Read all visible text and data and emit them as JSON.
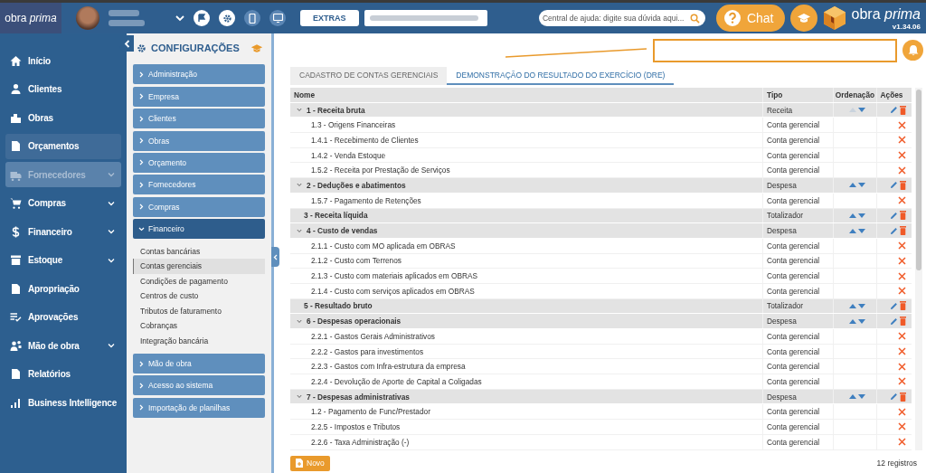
{
  "header": {
    "logo": "obra *prima*",
    "extras_button": "EXTRAS",
    "search": {
      "placeholder": "Central de ajuda: digite sua dúvida aqui..."
    },
    "chat_button": "Chat",
    "brand": "obra *prima*",
    "version": "v1.34.06"
  },
  "sidebar": {
    "items": [
      {
        "label": "Início",
        "has_submenu": false,
        "selected": false,
        "disabled": false
      },
      {
        "label": "Clientes",
        "has_submenu": false,
        "selected": false,
        "disabled": false
      },
      {
        "label": "Obras",
        "has_submenu": false,
        "selected": false,
        "disabled": false
      },
      {
        "label": "Orçamentos",
        "has_submenu": false,
        "selected": true,
        "disabled": false
      },
      {
        "label": "Fornecedores",
        "has_submenu": true,
        "selected": false,
        "disabled": true
      },
      {
        "label": "Compras",
        "has_submenu": true,
        "selected": false,
        "disabled": false
      },
      {
        "label": "Financeiro",
        "has_submenu": true,
        "selected": false,
        "disabled": false
      },
      {
        "label": "Estoque",
        "has_submenu": true,
        "selected": false,
        "disabled": false
      },
      {
        "label": "Apropriação",
        "has_submenu": false,
        "selected": false,
        "disabled": false
      },
      {
        "label": "Aprovações",
        "has_submenu": false,
        "selected": false,
        "disabled": false
      },
      {
        "label": "Mão de obra",
        "has_submenu": true,
        "selected": false,
        "disabled": false
      },
      {
        "label": "Relatórios",
        "has_submenu": false,
        "selected": false,
        "disabled": false
      },
      {
        "label": "Business Intelligence",
        "has_submenu": false,
        "selected": false,
        "disabled": false
      }
    ]
  },
  "settings_panel": {
    "title": "CONFIGURAÇÕES",
    "sections": [
      {
        "label": "Administração",
        "expanded": false
      },
      {
        "label": "Empresa",
        "expanded": false
      },
      {
        "label": "Clientes",
        "expanded": false
      },
      {
        "label": "Obras",
        "expanded": false
      },
      {
        "label": "Orçamento",
        "expanded": false
      },
      {
        "label": "Fornecedores",
        "expanded": false
      },
      {
        "label": "Compras",
        "expanded": false
      },
      {
        "label": "Financeiro",
        "expanded": true,
        "children": [
          {
            "label": "Contas bancárias",
            "selected": false
          },
          {
            "label": "Contas gerenciais",
            "selected": true
          },
          {
            "label": "Condições de pagamento",
            "selected": false
          },
          {
            "label": "Centros de custo",
            "selected": false
          },
          {
            "label": "Tributos de faturamento",
            "selected": false
          },
          {
            "label": "Cobranças",
            "selected": false
          },
          {
            "label": "Integração bancária",
            "selected": false
          }
        ]
      },
      {
        "label": "Mão de obra",
        "expanded": false
      },
      {
        "label": "Acesso ao sistema",
        "expanded": false
      },
      {
        "label": "Importação de planilhas",
        "expanded": false
      }
    ]
  },
  "tabs": [
    {
      "label": "CADASTRO DE CONTAS GERENCIAIS",
      "selected": false
    },
    {
      "label": "DEMONSTRAÇÃO DO RESULTADO DO EXERCÍCIO (DRE)",
      "selected": true
    }
  ],
  "table": {
    "columns": [
      "Nome",
      "Tipo",
      "Ordenação",
      "Ações"
    ],
    "rows": [
      {
        "kind": "group",
        "name": "1 - Receita bruta",
        "type": "Receita",
        "up_disabled": true
      },
      {
        "kind": "account",
        "name": "1.3 - Origens Financeiras",
        "type": "Conta gerencial"
      },
      {
        "kind": "account",
        "name": "1.4.1 - Recebimento de Clientes",
        "type": "Conta gerencial"
      },
      {
        "kind": "account",
        "name": "1.4.2 - Venda Estoque",
        "type": "Conta gerencial"
      },
      {
        "kind": "account",
        "name": "1.5.2 - Receita por Prestação de Serviços",
        "type": "Conta gerencial"
      },
      {
        "kind": "group",
        "name": "2 - Deduções e abatimentos",
        "type": "Despesa",
        "up_disabled": false
      },
      {
        "kind": "account",
        "name": "1.5.7 - Pagamento de Retenções",
        "type": "Conta gerencial"
      },
      {
        "kind": "total",
        "name": "3 - Receita líquida",
        "type": "Totalizador",
        "up_disabled": false
      },
      {
        "kind": "group",
        "name": "4 - Custo de vendas",
        "type": "Despesa",
        "up_disabled": false
      },
      {
        "kind": "account",
        "name": "2.1.1 - Custo com MO aplicada em OBRAS",
        "type": "Conta gerencial"
      },
      {
        "kind": "account",
        "name": "2.1.2 - Custo com Terrenos",
        "type": "Conta gerencial"
      },
      {
        "kind": "account",
        "name": "2.1.3 - Custo com materiais aplicados em OBRAS",
        "type": "Conta gerencial"
      },
      {
        "kind": "account",
        "name": "2.1.4 - Custo com serviços aplicados em OBRAS",
        "type": "Conta gerencial"
      },
      {
        "kind": "total",
        "name": "5 - Resultado bruto",
        "type": "Totalizador",
        "up_disabled": false
      },
      {
        "kind": "group",
        "name": "6 - Despesas operacionais",
        "type": "Despesa",
        "up_disabled": false
      },
      {
        "kind": "account",
        "name": "2.2.1 - Gastos Gerais Administrativos",
        "type": "Conta gerencial"
      },
      {
        "kind": "account",
        "name": "2.2.2 - Gastos para investimentos",
        "type": "Conta gerencial"
      },
      {
        "kind": "account",
        "name": "2.2.3 - Gastos com Infra-estrutura da empresa",
        "type": "Conta gerencial"
      },
      {
        "kind": "account",
        "name": "2.2.4 - Devolução de Aporte de Capital a Coligadas",
        "type": "Conta gerencial"
      },
      {
        "kind": "group",
        "name": "7 - Despesas administrativas",
        "type": "Despesa",
        "up_disabled": false
      },
      {
        "kind": "account",
        "name": "1.2 - Pagamento de Func/Prestador",
        "type": "Conta gerencial"
      },
      {
        "kind": "account",
        "name": "2.2.5 - Impostos e Tributos",
        "type": "Conta gerencial"
      },
      {
        "kind": "account",
        "name": "2.2.6 - Taxa Administração (-)",
        "type": "Conta gerencial"
      }
    ]
  },
  "footer": {
    "new_button": "Novo",
    "record_count": "12 registros"
  }
}
